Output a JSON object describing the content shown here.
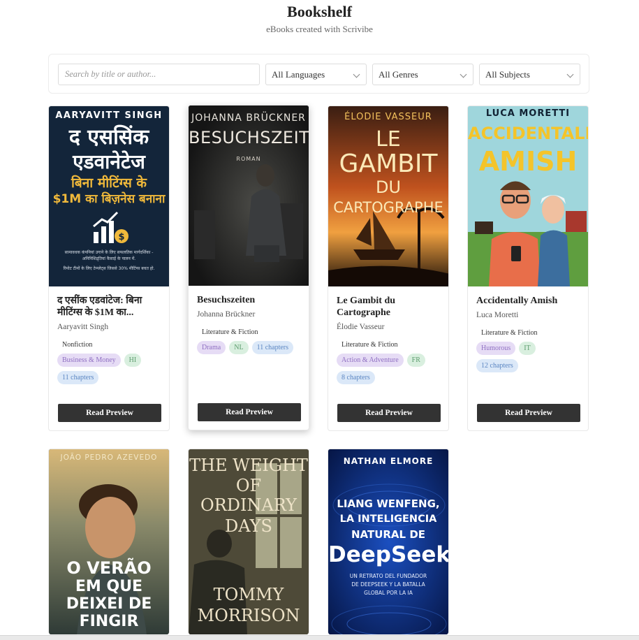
{
  "header": {
    "title": "Bookshelf",
    "subtitle": "eBooks created with Scrivibe"
  },
  "filters": {
    "search_placeholder": "Search by title or author...",
    "language": "All Languages",
    "genre": "All Genres",
    "subject": "All Subjects"
  },
  "read_label": "Read Preview",
  "books": [
    {
      "title": "द एसींक एडवांटेज: बिना मीटिंग्स के $1M का...",
      "author": "Aaryavitt Singh",
      "category": "Nonfiction",
      "genre": "Business & Money",
      "lang": "HI",
      "chapters": "11 chapters",
      "cover": {
        "author": "AARYAVITT SINGH",
        "line1": "द एससिंक",
        "line2": "एडवानेटेज",
        "line3": "बिना मीटिंग्स के",
        "line4": "$1M का बिज़नेस बनाना",
        "blurb": "सामावधक कंपनियां उगाने के लिए सफलतिक मार्गदर्शिका - अनिनिशिद्र्तियां कैसाई के पालन में.",
        "blurb2": "रिमोट टीमों के लिए टेम्प्लेट्स जिससे 30% मीटिंग्स बचत हो.",
        "icon": "growth-chart-dollar-icon"
      }
    },
    {
      "title": "Besuchszeiten",
      "author": "Johanna Brückner",
      "category": "Literature & Fiction",
      "genre": "Drama",
      "lang": "NL",
      "chapters": "11 chapters",
      "cover": {
        "author": "JOHANNA BRÜCKNER",
        "title": "BESUCHSZEITEN",
        "sub": "ROMAN"
      }
    },
    {
      "title": "Le Gambit du Cartographe",
      "author": "Élodie Vasseur",
      "category": "Literature & Fiction",
      "genre": "Action & Adventure",
      "lang": "FR",
      "chapters": "8 chapters",
      "cover": {
        "author": "ÉLODIE VASSEUR",
        "l1": "LE",
        "l2": "GAMBIT",
        "l3": "DU",
        "l4": "CARTOGRAPHE"
      }
    },
    {
      "title": "Accidentally Amish",
      "author": "Luca Moretti",
      "category": "Literature & Fiction",
      "genre": "Humorous",
      "lang": "IT",
      "chapters": "12 chapters",
      "cover": {
        "author": "LUCA MORETTI",
        "l1": "ACCIDENTALLY",
        "l2": "AMISH"
      }
    },
    {
      "cover": {
        "author": "JOÃO PEDRO AZEVEDO",
        "l1": "O VERÃO",
        "l2": "EM QUE",
        "l3": "DEIXEI DE",
        "l4": "FINGIR"
      }
    },
    {
      "cover": {
        "l1": "THE WEIGHT",
        "l2": "OF",
        "l3": "ORDINARY",
        "l4": "DAYS",
        "a1": "TOMMY",
        "a2": "MORRISON"
      }
    },
    {
      "cover": {
        "author": "NATHAN ELMORE",
        "l1": "LIANG WENFENG,",
        "l2": "LA INTELIGENCIA",
        "l3": "NATURAL DE",
        "l4": "DeepSeek",
        "s1": "UN RETRATO DEL FUNDADOR",
        "s2": "DE DEEPSEEK Y LA BATALLA",
        "s3": "GLOBAL POR LA IA"
      }
    }
  ],
  "colors": {
    "button": "#333333",
    "genre_tag": "#e6dcf5",
    "lang_tag": "#d9efdf",
    "chapters_tag": "#dbe8f8"
  }
}
